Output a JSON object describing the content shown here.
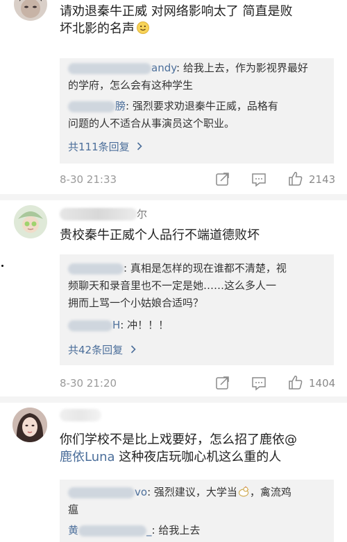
{
  "comments": [
    {
      "name_suffix": "",
      "text_lines": [
        "请劝退秦牛正威 对网络影响太了 简直是败",
        "坏北影的名声"
      ],
      "emoji": "slightly-smiling-face",
      "replies": [
        {
          "name_visible": "andy",
          "lines": [
            ": 给我上去，作为影视界最好",
            "的学府，怎么会有这种学生"
          ]
        },
        {
          "name_visible": "膀",
          "lines": [
            ": 强烈要求劝退秦牛正威，品格有",
            "问题的人不适合从事演员这个职业。"
          ]
        }
      ],
      "more_replies": "共111条回复",
      "time": "8-30 21:33",
      "likes": "2143"
    },
    {
      "name_suffix": "尔",
      "text_lines": [
        "贵校秦牛正威个人品行不端道德败坏"
      ],
      "replies": [
        {
          "name_visible": "",
          "lines": [
            ": 真相是怎样的现在谁都不清楚，视",
            "频聊天和录音里也不一定是她……这么多人一",
            "拥而上骂一个小姑娘合适吗？"
          ]
        },
        {
          "name_visible": "H",
          "lines": [
            ": 冲！！！"
          ]
        }
      ],
      "more_replies": "共42条回复",
      "time": "8-30 21:20",
      "likes": "1404"
    },
    {
      "name_suffix": "",
      "text_lines": [
        "你们学校不是比上戏要好，怎么招了鹿依@",
        "鹿依Luna 这种夜店玩咖心机这么重的人"
      ],
      "mention": "鹿依Luna",
      "replies": [
        {
          "name_visible": "vo",
          "lines": [
            ": 强烈建议，大学当",
            "瘟"
          ],
          "line1_tail": "，禽流鸡"
        },
        {
          "name_visible": "黄",
          "lines": [
            ": 给我上去"
          ]
        }
      ]
    }
  ],
  "colors": {
    "link": "#4b6e9a",
    "reply_bg": "#f2f2f2",
    "meta": "#9a9a9a"
  },
  "icons": [
    "share-icon",
    "comment-icon",
    "like-icon",
    "chicken-emoji"
  ]
}
